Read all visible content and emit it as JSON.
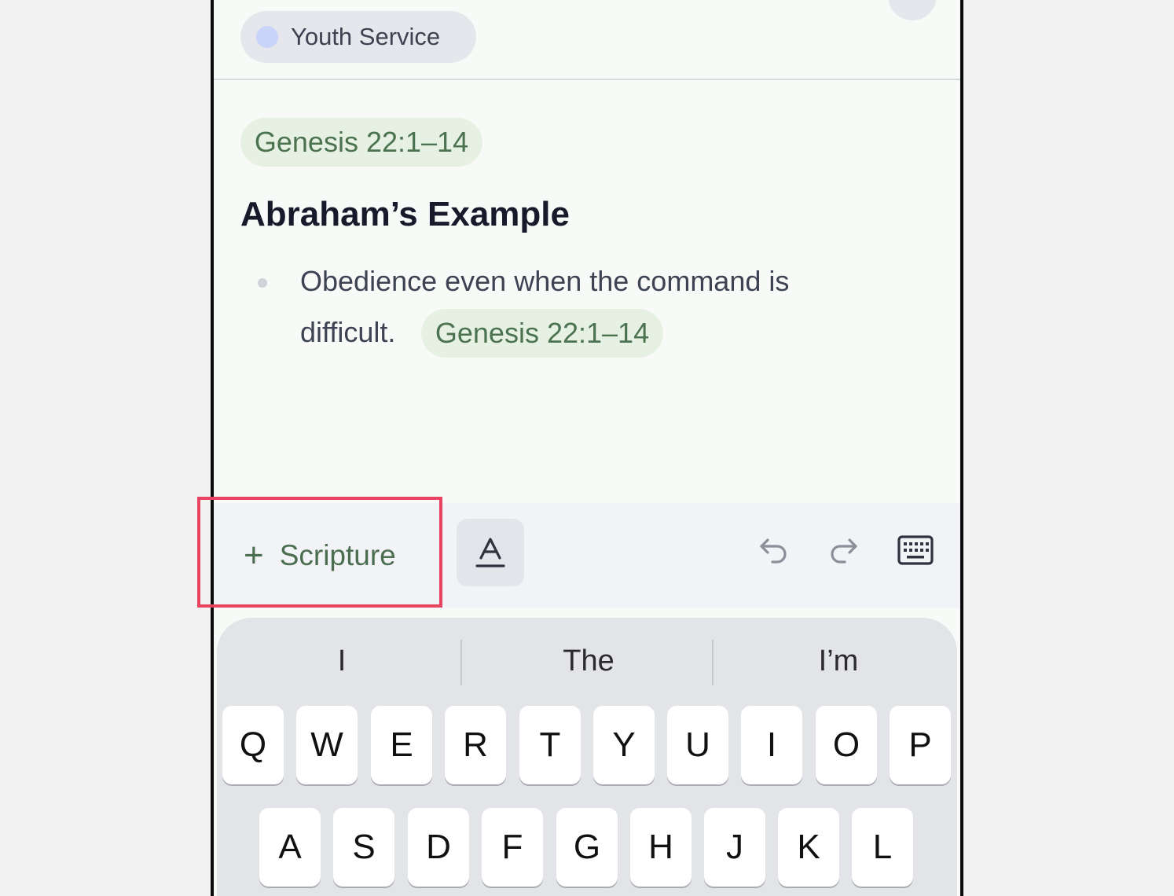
{
  "header": {
    "service_chip_label": "Youth Service",
    "add_button_label": "+"
  },
  "content": {
    "scripture_reference": "Genesis 22:1–14",
    "heading": "Abraham’s Example",
    "bullet_text_line1": "Obedience even when the command is",
    "bullet_text_line2": "difficult.",
    "bullet_reference": "Genesis 22:1–14"
  },
  "toolbar": {
    "scripture_button_label": "Scripture",
    "icons": [
      "plus-icon",
      "text-format-icon",
      "undo-icon",
      "redo-icon",
      "keyboard-icon"
    ]
  },
  "keyboard": {
    "suggestions": [
      "I",
      "The",
      "I’m"
    ],
    "row1": [
      "Q",
      "W",
      "E",
      "R",
      "T",
      "Y",
      "U",
      "I",
      "O",
      "P"
    ],
    "row2": [
      "A",
      "S",
      "D",
      "F",
      "G",
      "H",
      "J",
      "K",
      "L"
    ]
  },
  "colors": {
    "accent_green": "#4c7350",
    "chip_green_bg": "#e6f1e3",
    "highlight_red": "#e84360",
    "service_dot": "#c9d3f9"
  }
}
